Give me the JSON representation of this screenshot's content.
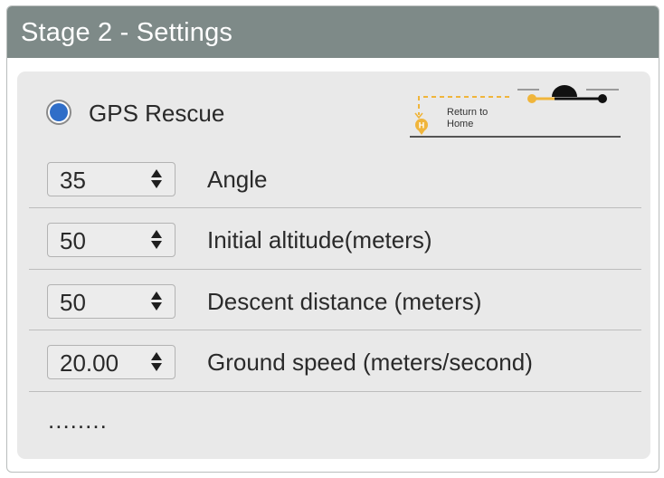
{
  "header": {
    "title": "Stage 2 - Settings"
  },
  "mode": {
    "label": "GPS Rescue",
    "selected": true,
    "illustration_caption_line1": "Return to",
    "illustration_caption_line2": "Home",
    "illustration_home_marker": "H",
    "accent_color": "#f0b53b"
  },
  "settings": [
    {
      "value": "35",
      "label": "Angle"
    },
    {
      "value": "50",
      "label": "Initial altitude(meters)"
    },
    {
      "value": "50",
      "label": "Descent distance (meters)"
    },
    {
      "value": "20.00",
      "label": "Ground speed (meters/second)"
    }
  ],
  "more": "........",
  "colors": {
    "header_bg": "#7e8a88",
    "radio_selected": "#2f6ec8",
    "body_bg": "#e9e9e9"
  },
  "icons": {
    "spin": "up-down-arrows-icon",
    "home": "home-pin-icon",
    "drone": "drone-icon"
  }
}
